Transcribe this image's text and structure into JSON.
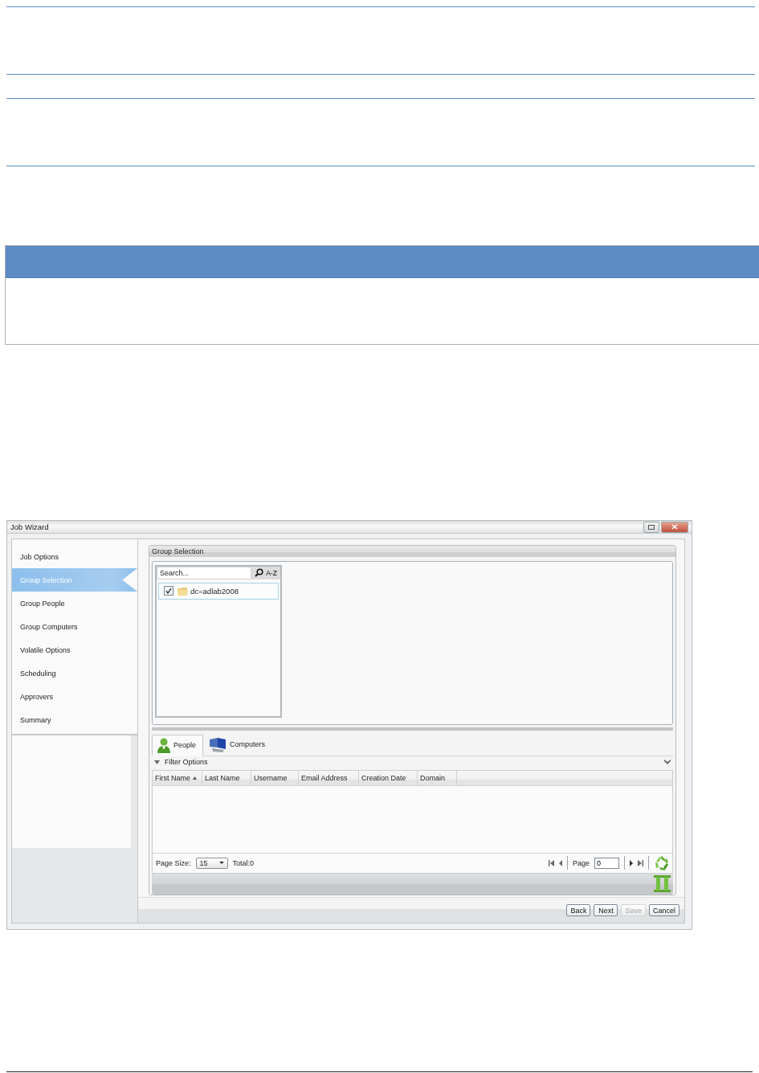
{
  "window": {
    "title": "Job Wizard"
  },
  "nav": [
    {
      "label": "Job Options",
      "selected": false
    },
    {
      "label": "Group Selection",
      "selected": true
    },
    {
      "label": "Group People",
      "selected": false
    },
    {
      "label": "Group Computers",
      "selected": false
    },
    {
      "label": "Volatile Options",
      "selected": false
    },
    {
      "label": "Scheduling",
      "selected": false
    },
    {
      "label": "Approvers",
      "selected": false
    },
    {
      "label": "Summary",
      "selected": false
    }
  ],
  "panel": {
    "title": "Group Selection"
  },
  "tree": {
    "search": {
      "placeholder": "Search..."
    },
    "sort_button": "A-Z",
    "items": [
      {
        "label": "dc=adlab2008",
        "checked": true
      }
    ]
  },
  "tabs": [
    {
      "label": "People",
      "selected": true
    },
    {
      "label": "Computers",
      "selected": false
    }
  ],
  "filter": {
    "label": "Filter Options"
  },
  "grid": {
    "columns": [
      {
        "label": "First Name",
        "sorted": true
      },
      {
        "label": "Last Name",
        "sorted": false
      },
      {
        "label": "Username",
        "sorted": false
      },
      {
        "label": "Email Address",
        "sorted": false
      },
      {
        "label": "Creation Date",
        "sorted": false
      },
      {
        "label": "Domain",
        "sorted": false
      }
    ]
  },
  "pager": {
    "page_size_label": "Page Size:",
    "page_size": "15",
    "total": "Total:0",
    "page_label": "Page",
    "page": "0"
  },
  "buttons": [
    {
      "label": "Back",
      "disabled": false
    },
    {
      "label": "Next",
      "disabled": false
    },
    {
      "label": "Save",
      "disabled": true
    },
    {
      "label": "Cancel",
      "disabled": false
    }
  ]
}
